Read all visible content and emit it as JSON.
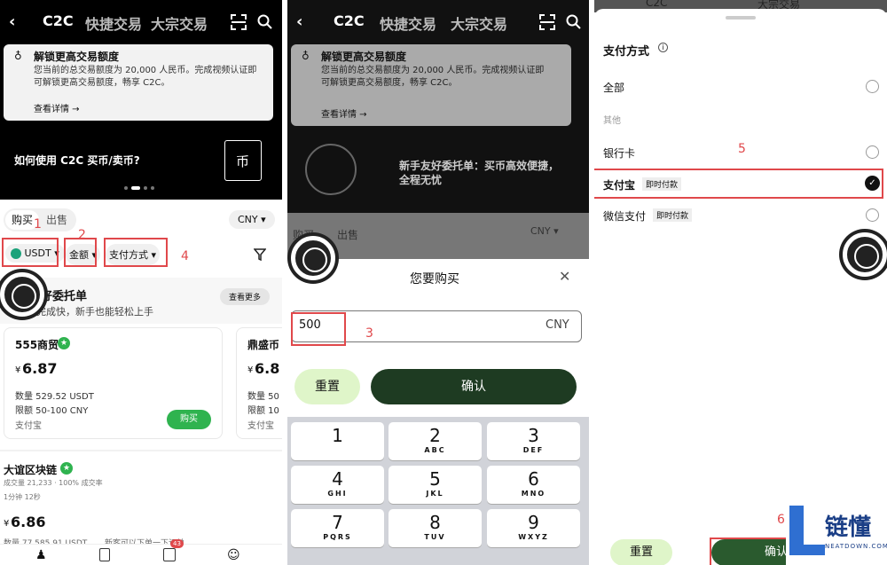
{
  "p1": {
    "tabs": {
      "c2c": "C2C",
      "quick": "快捷交易",
      "bulk": "大宗交易"
    },
    "notice": {
      "title": "解锁更高交易额度",
      "body1": "您当前的总交易额度为 20,000 人民币。完成视频认证即",
      "body2": "可解锁更高交易额度，畅享 C2C。",
      "link": "查看详情 →"
    },
    "banner": "如何使用 C2C 买币/卖币?",
    "trade": {
      "buy": "购买",
      "sell": "出售",
      "currency": "CNY ▾"
    },
    "filters": {
      "coin": "USDT ▾",
      "amount": "金额 ▾",
      "pay": "支付方式 ▾"
    },
    "labels": {
      "n1": "1",
      "n2": "2",
      "n4": "4"
    },
    "section": {
      "title": "好委托单",
      "sub": "、完成快，新手也能轻松上手",
      "more": "查看更多"
    },
    "m1": {
      "name": "555商贸",
      "price_sym": "¥",
      "price": "6.87",
      "qty": "数量 529.52 USDT",
      "lim": "限额 50-100 CNY",
      "pay": "支付宝",
      "buy": "购买"
    },
    "m2": {
      "name": "鼎盛币",
      "price_sym": "¥",
      "price": "6.8",
      "qty": "数量 50",
      "lim": "限额 10",
      "pay": "支付宝"
    },
    "m3": {
      "name": "大谊区块链",
      "stats": "成交量 21,233 · 100% 成交率",
      "time": "1分钟 12秒",
      "price_sym": "¥",
      "price": "6.86",
      "qty": "数量 77,585.91 USDT",
      "extra": "新客可以下单一下订单"
    },
    "nav_badge": "43"
  },
  "p2": {
    "tabs": {
      "c2c": "C2C",
      "quick": "快捷交易",
      "bulk": "大宗交易"
    },
    "notice": {
      "title": "解锁更高交易额度",
      "body1": "您当前的总交易额度为 20,000 人民币。完成视频认证即",
      "body2": "可解锁更高交易额度，畅享 C2C。",
      "link": "查看详情 →"
    },
    "banner1": "新手友好委托单：买币高效便捷，",
    "banner2": "全程无忧",
    "trade": {
      "buy": "购买",
      "sell": "出售",
      "currency": "CNY ▾"
    },
    "sheet": {
      "title": "您要购买",
      "value": "500",
      "unit": "CNY",
      "reset": "重置",
      "confirm": "确认"
    },
    "label3": "3",
    "keys": [
      {
        "n": "1",
        "l": ""
      },
      {
        "n": "2",
        "l": "ABC"
      },
      {
        "n": "3",
        "l": "DEF"
      },
      {
        "n": "4",
        "l": "GHI"
      },
      {
        "n": "5",
        "l": "JKL"
      },
      {
        "n": "6",
        "l": "MNO"
      },
      {
        "n": "7",
        "l": "PQRS"
      },
      {
        "n": "8",
        "l": "TUV"
      },
      {
        "n": "9",
        "l": "WXYZ"
      }
    ]
  },
  "p3": {
    "tabs": {
      "c2c": "C2C",
      "bulk": "大宗交易"
    },
    "title": "支付方式",
    "all": "全部",
    "other": "其他",
    "bank": "银行卡",
    "alipay": "支付宝",
    "alipay_tag": "即时付款",
    "wechat": "微信支付",
    "wechat_tag": "即时付款",
    "label5": "5",
    "label6": "6",
    "reset": "重置",
    "confirm": "确认"
  },
  "watermark": {
    "cn": "链懂",
    "en": "NEATDOWN.COM"
  },
  "colors": {
    "green": "#2fb34f",
    "dark_green": "#1e3b22",
    "light_green": "#dff5c9",
    "red": "#e0484b"
  }
}
